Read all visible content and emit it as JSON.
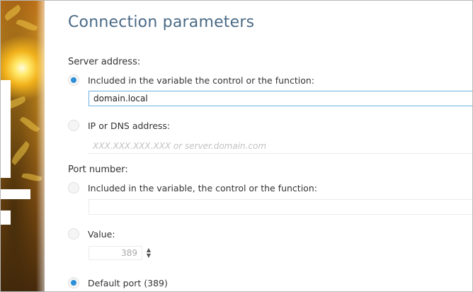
{
  "page": {
    "title": "Connection parameters"
  },
  "server_address": {
    "label": "Server address:",
    "option_variable": {
      "label": "Included in the variable the control or the function:",
      "selected": true,
      "value": "domain.local"
    },
    "option_ip": {
      "label": "IP or DNS address:",
      "selected": false,
      "placeholder": "XXX.XXX.XXX.XXX or server.domain.com"
    }
  },
  "port_number": {
    "label": "Port number:",
    "option_variable": {
      "label": "Included in the variable, the control or the function:",
      "selected": false,
      "value": ""
    },
    "option_value": {
      "label": "Value:",
      "selected": false,
      "value": "389"
    },
    "option_default": {
      "label": "Default port (389)",
      "selected": true
    }
  },
  "icons": {
    "spinner_up": "▲",
    "spinner_down": "▼"
  },
  "colors": {
    "title": "#4a6a86",
    "radio_selected": "#2d8fd6",
    "active_input_border": "#6cb0e0"
  }
}
